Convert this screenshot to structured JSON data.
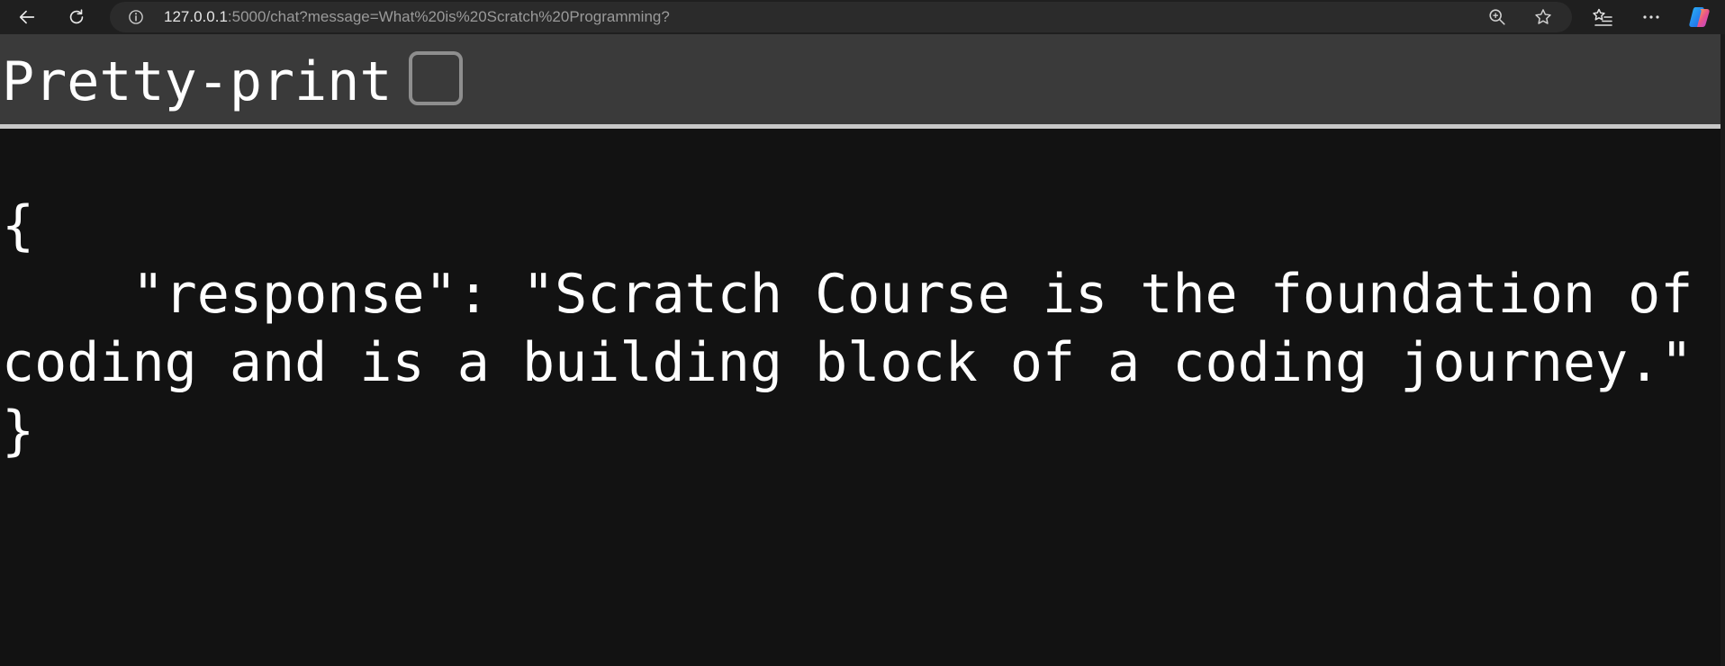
{
  "browser": {
    "url_host": "127.0.0.1",
    "url_rest": ":5000/chat?message=What%20is%20Scratch%20Programming?",
    "icons": {
      "back": "back-arrow-icon",
      "refresh": "refresh-icon",
      "info": "info-icon",
      "zoom": "zoom-icon",
      "favorite": "star-icon",
      "favorites_list": "favorites-list-icon",
      "more": "more-icon",
      "copilot": "copilot-icon"
    }
  },
  "viewer": {
    "pretty_print_label": "Pretty-print",
    "pretty_print_checked": false
  },
  "json_text": "{\n    \"response\": \"Scratch Course is the foundation of coding and is a building block of a coding journey.\"\n}",
  "colors": {
    "page_bg": "#121212",
    "toolbar_bg": "#1f1f1f",
    "pretty_bar_bg": "#3a3a3a",
    "text": "#ffffff"
  }
}
